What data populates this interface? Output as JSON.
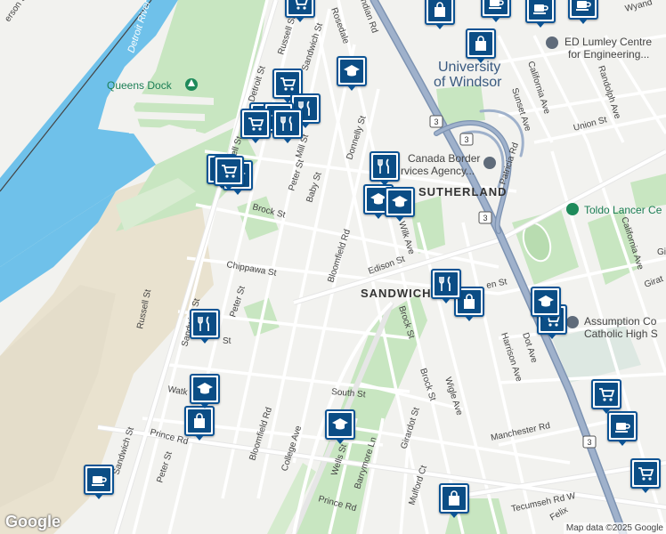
{
  "water_labels": {
    "river": "Detroit River"
  },
  "poi_labels": {
    "queens_dock": "Queens Dock",
    "university_line1": "University",
    "university_line2": "of Windsor",
    "lumley_line1": "ED Lumley Centre",
    "lumley_line2": "for Engineering...",
    "border_line1": "Canada Border",
    "border_line2": "rvices Agency...",
    "toldo": "Toldo Lancer Ce",
    "assumption_line1": "Assumption Co",
    "assumption_line2": "Catholic High S"
  },
  "area_labels": {
    "sutherland": "SUTHERLAND",
    "sandwich": "SANDWICH"
  },
  "street_labels": {
    "erson": "erson St",
    "rosedale": "Rosedale",
    "indian": "ndian Rd",
    "russell_top": "Russell St",
    "sandwich_top": "Sandwich St",
    "detroit": "Detroit St",
    "mill": "Mill St",
    "donnelly": "Donnelly St",
    "peter_top": "Peter St",
    "baby": "Baby St",
    "russell_mid": "ssell St",
    "brock_top": "Brock St",
    "bloomfield_top": "Bloomfield Rd",
    "chippawa": "Chippawa St",
    "peter_mid": "Peter St",
    "edison": "Edison St",
    "wilk": "Wilk Ave",
    "en": "en St",
    "russell_low": "Russell St",
    "sandwich_low": "Sandwich St",
    "brock_low1": "Brock St",
    "brock_low2": "Brock St",
    "wigle": "Wigle Ave",
    "harrison": "Harrison Ave",
    "dot": "Dot Ave",
    "st_frag": "St",
    "watk": "Watk",
    "south": "South St",
    "bloomfield_low": "Bloomfield Rd",
    "college": "College Ave",
    "sandwich_bottom": "Sandwich St",
    "prince_left": "Prince Rd",
    "peter_low": "Peter St",
    "wells": "Wells St",
    "barrymore": "Barrymore Ln",
    "girardot": "Girardot St",
    "mulford": "Mulford Ct",
    "prince_bottom": "Prince Rd",
    "manchester": "Manchester Rd",
    "tecumseh": "Tecumseh Rd W",
    "felix": "Felix",
    "california_top": "California Ave",
    "california_right": "California Ave",
    "sunset": "Sunset Ave",
    "randolph": "Randolph Ave",
    "union": "Union St",
    "patricia": "Patricia Rd",
    "wyand": "Wyand",
    "gi": "Gi",
    "girat": "Girat"
  },
  "highway_shields": [
    "3",
    "3",
    "3",
    "3"
  ],
  "markers": [
    {
      "id": "m1",
      "icon": "shopping-cart-icon"
    },
    {
      "id": "m2",
      "icon": "shopping-bag-icon"
    },
    {
      "id": "m3",
      "icon": "coffee-icon"
    },
    {
      "id": "m4",
      "icon": "coffee-icon"
    },
    {
      "id": "m5",
      "icon": "coffee-icon"
    },
    {
      "id": "m6",
      "icon": "shopping-bag-icon"
    },
    {
      "id": "m7",
      "icon": "school-icon"
    },
    {
      "id": "m8",
      "icon": "shopping-cart-icon"
    },
    {
      "id": "m9",
      "icon": "restaurant-icon"
    },
    {
      "id": "m10",
      "icon": "shopping-cart-icon"
    },
    {
      "id": "m11",
      "icon": "school-icon"
    },
    {
      "id": "m12",
      "icon": "restaurant-icon"
    },
    {
      "id": "m13",
      "icon": "school-icon"
    },
    {
      "id": "m14",
      "icon": "school-icon"
    },
    {
      "id": "m15",
      "icon": "restaurant-icon"
    },
    {
      "id": "m16",
      "icon": "shopping-bag-icon"
    },
    {
      "id": "m17",
      "icon": "school-icon"
    },
    {
      "id": "m18",
      "icon": "shopping-cart-icon"
    },
    {
      "id": "m19",
      "icon": "restaurant-icon"
    },
    {
      "id": "m20",
      "icon": "school-icon"
    },
    {
      "id": "m21",
      "icon": "shopping-bag-icon"
    },
    {
      "id": "m22",
      "icon": "school-icon"
    },
    {
      "id": "m23",
      "icon": "shopping-cart-icon"
    },
    {
      "id": "m24",
      "icon": "coffee-icon"
    },
    {
      "id": "m25",
      "icon": "coffee-icon"
    },
    {
      "id": "m26",
      "icon": "shopping-cart-icon"
    },
    {
      "id": "m27",
      "icon": "shopping-bag-icon"
    }
  ],
  "footer": {
    "logo": "Google",
    "attribution": "Map data ©2025 Google"
  },
  "colors": {
    "water": "#6fc1ea",
    "park": "#c8e6c1",
    "land": "#f2f2ef",
    "road": "#ffffff",
    "highway": "#8fa3bf",
    "marker": "#0b4d85"
  }
}
